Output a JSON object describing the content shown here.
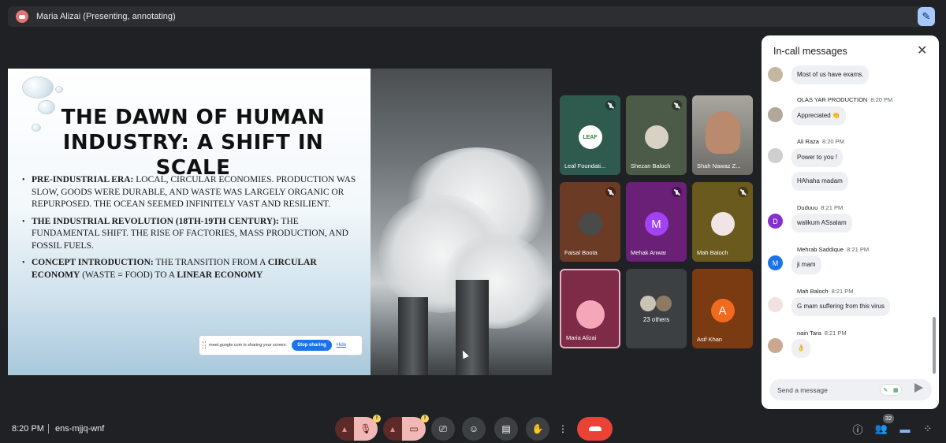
{
  "topbar": {
    "presenter_title": "Maria Alizai (Presenting, annotating)"
  },
  "slide": {
    "title": "THE DAWN OF HUMAN INDUSTRY: A SHIFT IN SCALE",
    "bullet1_bold": "PRE-INDUSTRIAL ERA:",
    "bullet1_text": " LOCAL, CIRCULAR ECONOMIES. PRODUCTION WAS SLOW, GOODS WERE DURABLE, AND WASTE WAS LARGELY ORGANIC OR REPURPOSED. THE OCEAN SEEMED INFINITELY VAST AND RESILIENT.",
    "bullet2_bold": "THE INDUSTRIAL REVOLUTION (18TH-19TH CENTURY):",
    "bullet2_text": " THE FUNDAMENTAL SHIFT. THE RISE OF FACTORIES, MASS PRODUCTION, AND FOSSIL FUELS.",
    "bullet3_bold": "CONCEPT INTRODUCTION:",
    "bullet3_text1": " THE TRANSITION FROM A ",
    "bullet3_bold2": "CIRCULAR ECONOMY",
    "bullet3_text2": " (WASTE = FOOD) TO A ",
    "bullet3_bold3": "LINEAR ECONOMY",
    "share_text": "meet.google.com is sharing your screen.",
    "stop_label": "Stop sharing",
    "hide_label": "Hide"
  },
  "participants": [
    {
      "name": "Leaf Foundati...",
      "color": "#2f5b4f"
    },
    {
      "name": "Shezan Baloch",
      "color": "#4c5a48"
    },
    {
      "name": "Shah Nawaz Z...",
      "color": "#8d8f86"
    },
    {
      "name": "Faisal Boota",
      "color": "#6b3b25"
    },
    {
      "name": "Mehak Anwar",
      "initial": "M",
      "color": "#6a2077",
      "avatar_color": "#a142f4"
    },
    {
      "name": "Mah Baloch",
      "color": "#6b5a1e"
    },
    {
      "name": "Maria Alizai",
      "color": "#7d2b47"
    },
    {
      "name": "23 others",
      "color": "#3c4043"
    },
    {
      "name": "Asif Khan",
      "initial": "A",
      "color": "#7a3a12",
      "avatar_color": "#f06a1f"
    }
  ],
  "chat": {
    "title": "In-call messages",
    "messages": [
      {
        "text": "Most of us have exams."
      },
      {
        "sender": "OLAS YAR PRODUCTION",
        "time": "8:20 PM",
        "text": "Appreciated 👏"
      },
      {
        "sender": "Ali Raza",
        "time": "8:20 PM",
        "text": "Power to you !",
        "text2": "HAhaha madam"
      },
      {
        "sender": "Duduuu",
        "time": "8:21 PM",
        "text": "walikum ASsalam",
        "initial": "D"
      },
      {
        "sender": "Mehrab Saddique",
        "time": "8:21 PM",
        "text": "ji mam",
        "initial": "M"
      },
      {
        "sender": "Mah Baloch",
        "time": "8:21 PM",
        "text": "G mam suffering from this virus"
      },
      {
        "sender": "nain Tara",
        "time": "8:21 PM",
        "text": "👌"
      }
    ],
    "input_placeholder": "Send a message"
  },
  "bottom": {
    "time": "8:20 PM",
    "meeting_code": "ens-mjjq-wnf",
    "people_count": "32",
    "warn": "!"
  }
}
